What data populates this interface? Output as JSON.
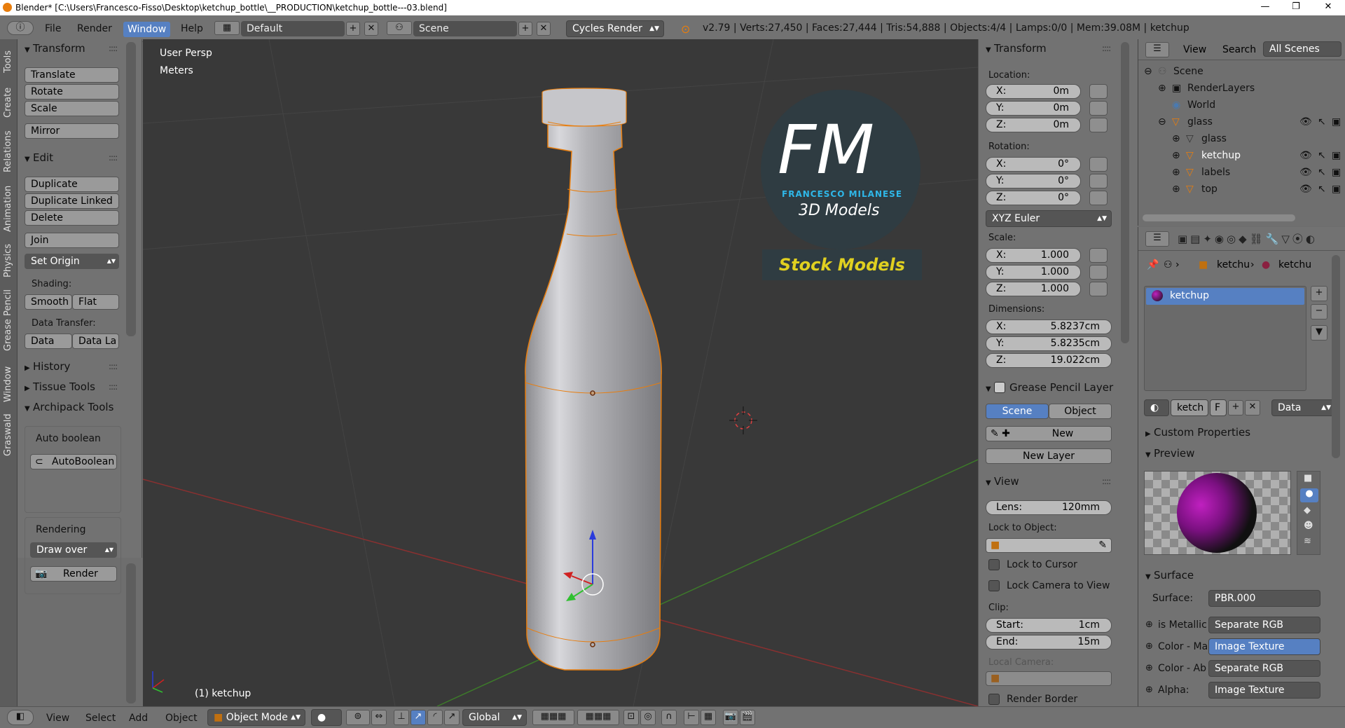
{
  "window": {
    "title": "Blender* [C:\\Users\\Francesco-Fisso\\Desktop\\ketchup_bottle\\__PRODUCTION\\ketchup_bottle---03.blend]",
    "minimize": "—",
    "maximize": "❐",
    "close": "✕"
  },
  "topbar": {
    "menus": [
      "File",
      "Render",
      "Window",
      "Help"
    ],
    "active_menu": "Window",
    "screen_layout": "Default",
    "scene": "Scene",
    "engine": "Cycles Render",
    "stats": "v2.79 | Verts:27,450 | Faces:27,444 | Tris:54,888 | Objects:4/4 | Lamps:0/0 | Mem:39.08M | ketchup"
  },
  "left_tabs": [
    "Tools",
    "Create",
    "Relations",
    "Animation",
    "Physics",
    "Grease Pencil",
    "Window",
    "Graswald"
  ],
  "toolshelf": {
    "transform_title": "Transform",
    "translate": "Translate",
    "rotate": "Rotate",
    "scale": "Scale",
    "mirror": "Mirror",
    "edit_title": "Edit",
    "duplicate": "Duplicate",
    "duplicate_linked": "Duplicate Linked",
    "delete": "Delete",
    "join": "Join",
    "set_origin": "Set Origin",
    "shading_label": "Shading:",
    "smooth": "Smooth",
    "flat": "Flat",
    "data_transfer_label": "Data Transfer:",
    "data": "Data",
    "data_la": "Data La",
    "history": "History",
    "tissue": "Tissue Tools",
    "archipack": "Archipack Tools",
    "auto_boolean_label": "Auto boolean",
    "auto_boolean_btn": "AutoBoolean",
    "rendering_label": "Rendering",
    "draw_over": "Draw over",
    "render_btn": "Render"
  },
  "viewport": {
    "view_name": "User Persp",
    "units": "Meters",
    "object_label": "(1) ketchup",
    "logo": {
      "letters": "FM",
      "name": "FRANCESCO MILANESE",
      "sub": "3D Models",
      "badge": "Stock Models"
    }
  },
  "properties_panel": {
    "transform_title": "Transform",
    "location_label": "Location:",
    "location": [
      {
        "k": "X:",
        "v": "0m"
      },
      {
        "k": "Y:",
        "v": "0m"
      },
      {
        "k": "Z:",
        "v": "0m"
      }
    ],
    "rotation_label": "Rotation:",
    "rotation": [
      {
        "k": "X:",
        "v": "0°"
      },
      {
        "k": "Y:",
        "v": "0°"
      },
      {
        "k": "Z:",
        "v": "0°"
      }
    ],
    "rotation_mode": "XYZ Euler",
    "scale_label": "Scale:",
    "scale": [
      {
        "k": "X:",
        "v": "1.000"
      },
      {
        "k": "Y:",
        "v": "1.000"
      },
      {
        "k": "Z:",
        "v": "1.000"
      }
    ],
    "dimensions_label": "Dimensions:",
    "dimensions": [
      {
        "k": "X:",
        "v": "5.8237cm"
      },
      {
        "k": "Y:",
        "v": "5.8235cm"
      },
      {
        "k": "Z:",
        "v": "19.022cm"
      }
    ],
    "grease_title": "Grease Pencil Layer",
    "scene_tab": "Scene",
    "object_tab": "Object",
    "new": "New",
    "new_layer": "New Layer",
    "view_title": "View",
    "lens": {
      "k": "Lens:",
      "v": "120mm"
    },
    "lock_to_object": "Lock to Object:",
    "lock_to_cursor": "Lock to Cursor",
    "lock_camera": "Lock Camera to View",
    "clip_label": "Clip:",
    "clip_start": {
      "k": "Start:",
      "v": "1cm"
    },
    "clip_end": {
      "k": "End:",
      "v": "15m"
    },
    "local_camera": "Local Camera:",
    "render_border": "Render Border"
  },
  "outliner": {
    "view": "View",
    "search": "Search",
    "all_scenes": "All Scenes",
    "items": [
      "Scene",
      "RenderLayers",
      "World",
      "glass",
      "glass",
      "ketchup",
      "labels",
      "top"
    ]
  },
  "prop_editor": {
    "crumb1": "ketchu",
    "crumb2": "ketchu",
    "material_slot": "ketchup",
    "mat_name": "ketch",
    "mat_f": "F",
    "data_dd": "Data",
    "custom_props": "Custom Properties",
    "preview": "Preview",
    "surface_title": "Surface",
    "surface_label": "Surface:",
    "surface_value": "PBR.000",
    "rows": [
      {
        "k": "is Metallic",
        "v": "Separate RGB"
      },
      {
        "k": "Color - Ma",
        "v": "Image Texture"
      },
      {
        "k": "Color - Ab",
        "v": "Separate RGB"
      },
      {
        "k": "Alpha:",
        "v": "Image Texture"
      }
    ]
  },
  "bottombar": {
    "menus": [
      "View",
      "Select",
      "Add",
      "Object"
    ],
    "mode": "Object Mode",
    "orientation": "Global"
  },
  "colors": {
    "selection": "#5680c2",
    "active_outline": "#e87d0d",
    "viewport_bg": "#393939",
    "panel": "#727272"
  }
}
